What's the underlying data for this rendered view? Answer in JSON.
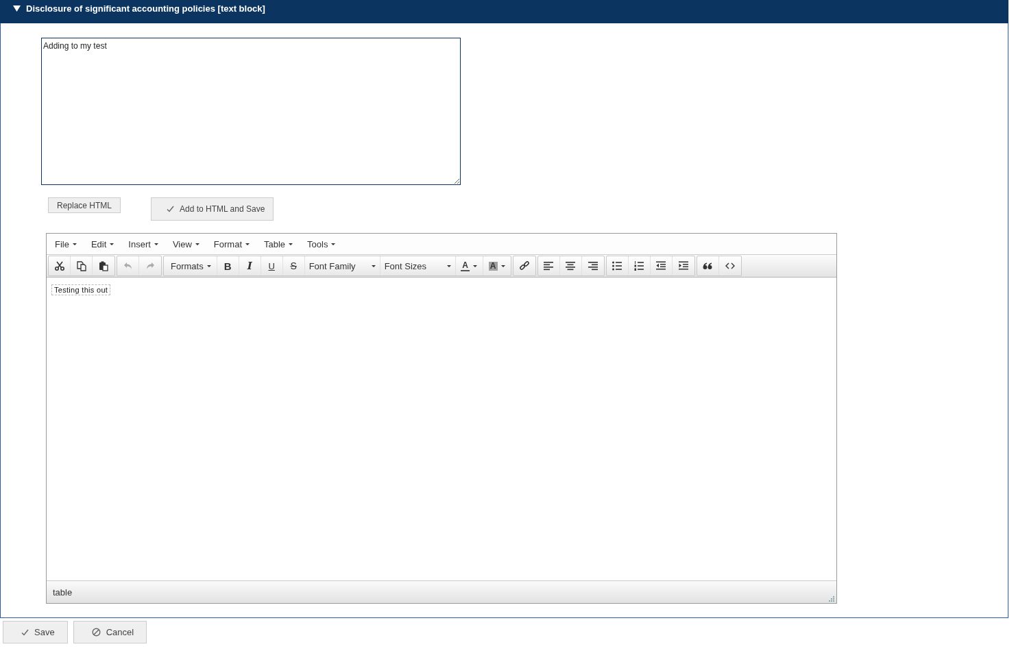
{
  "section": {
    "title": "Disclosure of significant accounting policies [text block]",
    "expanded": true
  },
  "source_box": {
    "value": "Adding to my test"
  },
  "actions": [
    {
      "label": "Replace HTML",
      "kind": "plain"
    },
    {
      "label": "Add to HTML and Save",
      "kind": "check"
    }
  ],
  "editor": {
    "menu": [
      {
        "label": "File"
      },
      {
        "label": "Edit"
      },
      {
        "label": "Insert"
      },
      {
        "label": "View"
      },
      {
        "label": "Format"
      },
      {
        "label": "Table"
      },
      {
        "label": "Tools"
      }
    ],
    "toolbar": [
      {
        "items": [
          {
            "kind": "icon",
            "disabled": false
          },
          {
            "kind": "icon",
            "disabled": false
          },
          {
            "kind": "icon",
            "disabled": false
          }
        ]
      },
      {
        "items": [
          {
            "kind": "icon",
            "disabled": true
          },
          {
            "kind": "icon",
            "disabled": true
          }
        ]
      },
      {
        "items": [
          {
            "kind": "dropdown",
            "label": "Formats"
          },
          {
            "kind": "bold",
            "label": "B"
          },
          {
            "kind": "italic",
            "label": "I"
          },
          {
            "kind": "underline",
            "label": "U"
          },
          {
            "kind": "strike",
            "label": "S"
          },
          {
            "kind": "select",
            "label": "Font Family"
          },
          {
            "kind": "select",
            "label": "Font Sizes"
          },
          {
            "kind": "textcolor",
            "label": "A",
            "color": "#555555"
          },
          {
            "kind": "bgcolor",
            "label": "A",
            "color": "#a0a0a0"
          }
        ]
      },
      {
        "items": [
          {
            "kind": "icon",
            "disabled": false
          }
        ]
      },
      {
        "items": [
          {
            "kind": "icon",
            "disabled": false
          },
          {
            "kind": "icon",
            "disabled": false
          },
          {
            "kind": "icon",
            "disabled": false
          }
        ]
      },
      {
        "items": [
          {
            "kind": "icon",
            "disabled": false
          },
          {
            "kind": "icon",
            "disabled": false
          },
          {
            "kind": "icon",
            "disabled": false
          },
          {
            "kind": "icon",
            "disabled": false
          }
        ]
      },
      {
        "items": [
          {
            "kind": "icon",
            "disabled": false
          },
          {
            "kind": "icon",
            "disabled": false
          }
        ]
      }
    ],
    "content": "Testing this out",
    "status_path": "table"
  },
  "footer": [
    {
      "label": "Save",
      "kind": "check"
    },
    {
      "label": "Cancel",
      "kind": "cancel"
    }
  ]
}
